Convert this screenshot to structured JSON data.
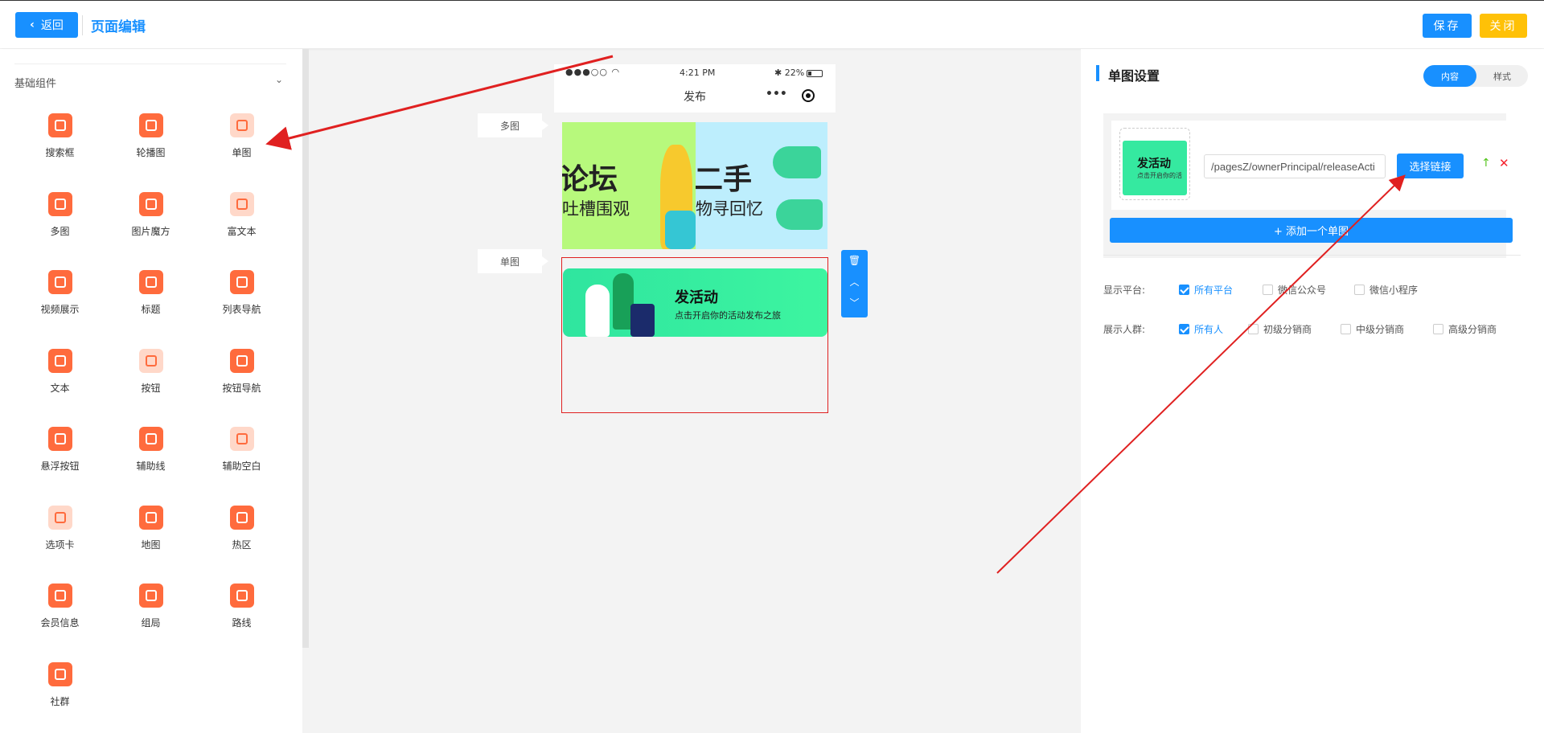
{
  "header": {
    "back_label": "返回",
    "title": "页面编辑",
    "save_label": "保存",
    "close_label": "关闭"
  },
  "sidebar": {
    "group_title": "基础组件",
    "components": [
      {
        "label": "搜索框",
        "icon": "search-box-icon"
      },
      {
        "label": "轮播图",
        "icon": "carousel-icon"
      },
      {
        "label": "单图",
        "icon": "single-image-icon"
      },
      {
        "label": "多图",
        "icon": "multi-image-icon"
      },
      {
        "label": "图片魔方",
        "icon": "image-cube-icon"
      },
      {
        "label": "富文本",
        "icon": "rich-text-icon"
      },
      {
        "label": "视频展示",
        "icon": "video-icon"
      },
      {
        "label": "标题",
        "icon": "title-icon"
      },
      {
        "label": "列表导航",
        "icon": "list-nav-icon"
      },
      {
        "label": "文本",
        "icon": "text-icon"
      },
      {
        "label": "按钮",
        "icon": "button-icon"
      },
      {
        "label": "按钮导航",
        "icon": "button-nav-icon"
      },
      {
        "label": "悬浮按钮",
        "icon": "float-button-icon"
      },
      {
        "label": "辅助线",
        "icon": "guide-line-icon"
      },
      {
        "label": "辅助空白",
        "icon": "blank-space-icon"
      },
      {
        "label": "选项卡",
        "icon": "tab-icon"
      },
      {
        "label": "地图",
        "icon": "map-icon"
      },
      {
        "label": "热区",
        "icon": "hotspot-icon"
      },
      {
        "label": "会员信息",
        "icon": "member-info-icon"
      },
      {
        "label": "组局",
        "icon": "group-icon"
      },
      {
        "label": "路线",
        "icon": "route-icon"
      },
      {
        "label": "社群",
        "icon": "community-icon"
      }
    ]
  },
  "canvas": {
    "status": {
      "signal": "●●●○○",
      "time": "4:21 PM",
      "battery": "22%"
    },
    "phone_title": "发布",
    "capsule": "•••",
    "tag_multi": "多图",
    "tag_single": "单图",
    "multi": {
      "left_big": "论坛",
      "left_small": "吐槽围观",
      "right_big": "二手",
      "right_small": "物寻回忆"
    },
    "banner": {
      "title": "发活动",
      "subtitle": "点击开启你的活动发布之旅"
    }
  },
  "settings": {
    "title": "单图设置",
    "tab_content": "内容",
    "tab_style": "样式",
    "thumb_title": "发活动",
    "thumb_sub": "点击开启你的活",
    "link_value": "/pagesZ/ownerPrincipal/releaseActi",
    "select_link_label": "选择链接",
    "add_label": "+ 添加一个单图",
    "platform_label": "显示平台:",
    "platforms": [
      {
        "label": "所有平台",
        "checked": true
      },
      {
        "label": "微信公众号",
        "checked": false
      },
      {
        "label": "微信小程序",
        "checked": false
      }
    ],
    "audience_label": "展示人群:",
    "audiences": [
      {
        "label": "所有人",
        "checked": true
      },
      {
        "label": "初级分销商",
        "checked": false
      },
      {
        "label": "中级分销商",
        "checked": false
      },
      {
        "label": "高级分销商",
        "checked": false
      }
    ]
  },
  "colors": {
    "primary": "#1890ff",
    "warning": "#ffc107",
    "accent": "#ff6b3d",
    "annotation": "#e02020"
  }
}
